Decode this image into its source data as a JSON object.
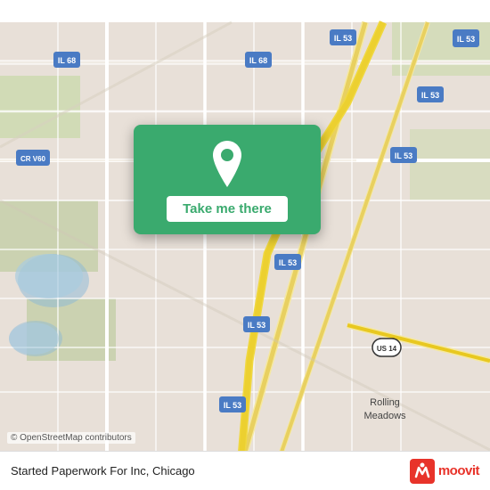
{
  "map": {
    "background_color": "#e8e0d8",
    "copyright": "© OpenStreetMap contributors"
  },
  "card": {
    "button_label": "Take me there",
    "pin_icon": "location-pin"
  },
  "bottom_bar": {
    "location_text": "Started Paperwork For Inc, Chicago",
    "brand_label": "moovit"
  },
  "route_labels": {
    "il68_top_left": "IL 68",
    "il68_top_center": "IL 68",
    "il53_top_right": "IL 53",
    "il53_mid_right1": "IL 53",
    "il53_mid_right2": "IL 53",
    "il53_center": "IL 53",
    "il53_lower": "IL 53",
    "il53_bottom": "IL 53",
    "crv60": "CR V60",
    "us14": "US 14",
    "rolling_meadows": "Rolling\nMeadows"
  }
}
